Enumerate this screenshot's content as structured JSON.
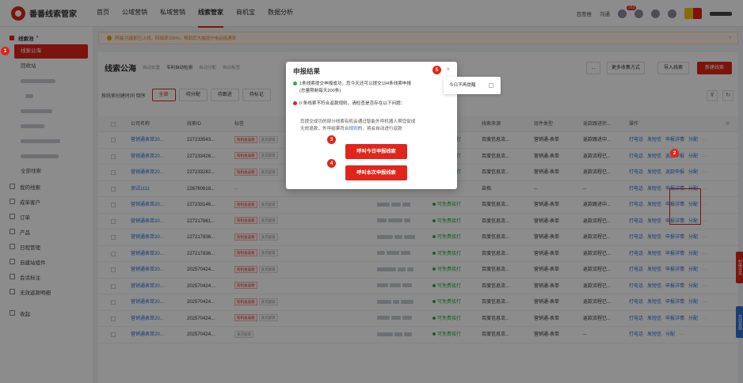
{
  "app": {
    "name": "番番线索管家"
  },
  "nav": {
    "links": [
      "首页",
      "公域营销",
      "私域营销",
      "线索管家",
      "商机宝",
      "数据分析"
    ],
    "right": {
      "baidu": "百度推",
      "chat": "沟通",
      "msg_count": "263"
    }
  },
  "sidebar": {
    "section": "线索池",
    "items": [
      "线索公海",
      "回收站"
    ],
    "all_leads": "全部线索",
    "nav": [
      "我的线索",
      "成单客户",
      "订单",
      "产品",
      "日程管理",
      "自建站组件",
      "会话标注",
      "无效返款明细",
      "收起"
    ]
  },
  "notice": {
    "text": "阿福 功能即已上线，回填率100%，帮助您大幅提升电话接通率"
  },
  "panel": {
    "title": "线索公海",
    "checks": [
      "自动去重",
      "专利自动检测",
      "自动分配",
      "自动标签"
    ],
    "buttons": {
      "more": "...",
      "collect": "更多收集方式",
      "import": "导入线索",
      "create": "新建线索"
    }
  },
  "filter": {
    "label": "按线索创建时间 倒序",
    "tabs": [
      "全部",
      "待分配",
      "待跟进",
      "待标记"
    ]
  },
  "table": {
    "headers": [
      "公司名称",
      "线索ID",
      "标签",
      "线索来源",
      "组件类型",
      "返款跟进状...",
      "操作"
    ],
    "rows": [
      {
        "company": "营销通表单20...",
        "id": "227233543...",
        "tags": [
          "有机会返款",
          "多次留资"
        ],
        "status": "可免费接打",
        "source": "百度信息流...",
        "type": "营销通-表单",
        "refund": "返款跟进中...",
        "ops": [
          "打电话",
          "发短信",
          "申报详情",
          "分配"
        ]
      },
      {
        "company": "营销通表单20...",
        "id": "227233426...",
        "tags": [
          "有机会返款",
          "多次留资"
        ],
        "status": "可免费接打",
        "source": "百度信息流...",
        "type": "营销通-表单",
        "refund": "返款流程已...",
        "ops": [
          "打电话",
          "发短信",
          "返款申报",
          "分配"
        ]
      },
      {
        "company": "营销通表单20...",
        "id": "227233282...",
        "tags": [
          "有机会返款",
          "多次留资"
        ],
        "status": "可免费接打",
        "source": "百度信息流...",
        "type": "营销通-表单",
        "refund": "返款流程已...",
        "ops": [
          "打电话",
          "发短信",
          "返款申报",
          "分配"
        ]
      },
      {
        "company": "测试1111",
        "id": "226760818...",
        "tags": [],
        "status": "",
        "source": "自拓",
        "type": "--",
        "refund": "--",
        "ops": [
          "打电话",
          "发短信",
          "申报详情",
          "分配"
        ]
      },
      {
        "company": "营销通表单20...",
        "id": "227233146...",
        "tags": [
          "有机会返款",
          "多次留资"
        ],
        "status": "可免费接打",
        "source": "百度信息流...",
        "type": "营销通-表单",
        "refund": "返款跟进中...",
        "ops": [
          "打电话",
          "发短信",
          "申报详情",
          "分配"
        ]
      },
      {
        "company": "营销通表单20...",
        "id": "227217861...",
        "tags": [
          "有机会返款",
          "多次留资"
        ],
        "status": "可免费接打",
        "source": "百度信息流...",
        "type": "营销通-表单",
        "refund": "返款流程已...",
        "ops": [
          "打电话",
          "发短信",
          "申报详情",
          "分配"
        ]
      },
      {
        "company": "营销通表单20...",
        "id": "227217836...",
        "tags": [
          "有机会返款",
          "多次留资"
        ],
        "status": "可免费接打",
        "source": "百度信息流...",
        "type": "营销通-表单",
        "refund": "返款流程已...",
        "ops": [
          "打电话",
          "发短信",
          "申报详情",
          "分配"
        ]
      },
      {
        "company": "营销通表单20...",
        "id": "227217836...",
        "tags": [
          "有机会返款",
          "多次留资"
        ],
        "status": "可免费接打",
        "source": "百度信息流...",
        "type": "营销通-表单",
        "refund": "返款流程已...",
        "ops": [
          "打电话",
          "发短信",
          "申报详情",
          "分配"
        ]
      },
      {
        "company": "营销通表单20...",
        "id": "202570424...",
        "tags": [
          "有机会返款",
          "多次留资"
        ],
        "status": "可免费接打",
        "source": "百度信息流...",
        "type": "营销通-表单",
        "refund": "返款流程已...",
        "ops": [
          "打电话",
          "发短信",
          "申报详情",
          "分配"
        ]
      },
      {
        "company": "营销通表单20...",
        "id": "202570424...",
        "tags": [
          "有机会返款"
        ],
        "status": "可免费接打",
        "source": "百度信息流...",
        "type": "营销通-表单",
        "refund": "返款流程已...",
        "ops": [
          "打电话",
          "发短信",
          "申报详情",
          "分配"
        ]
      },
      {
        "company": "营销通表单20...",
        "id": "202570424...",
        "tags": [
          "有机会返款",
          "多次留资"
        ],
        "status": "可免费接打",
        "source": "百度信息流...",
        "type": "营销通-表单",
        "refund": "返款流程已...",
        "ops": [
          "打电话",
          "发短信",
          "申报详情",
          "分配"
        ]
      },
      {
        "company": "营销通表单20...",
        "id": "202570424...",
        "tags": [
          "有机会返款",
          "多次留资"
        ],
        "status": "可免费接打",
        "source": "百度信息流...",
        "type": "营销通-表单",
        "refund": "返款流程已...",
        "ops": [
          "打电话",
          "发短信",
          "申报详情",
          "分配"
        ]
      },
      {
        "company": "营销通表单20...",
        "id": "202570424...",
        "tags": [
          "多次留资"
        ],
        "status": "可免费接打",
        "source": "百度信息流...",
        "type": "营销通-表单",
        "refund": "--",
        "ops": [
          "打电话",
          "发短信",
          "分配"
        ]
      }
    ]
  },
  "modal": {
    "title": "申报结果",
    "close": "×",
    "success_line1": "1条线索提交申报成功，您今天还可以提交194条线索申报",
    "success_line2": "(总量限制每天200条)",
    "fail_line": "0 条线索不符合返款规则，请检查是否存在以下问题：",
    "note_a": "您提交成功的部分线索有机会通过智能外呼机器人帮您促成",
    "note_b": "无效退款，外呼结果符合",
    "note_link": "规则",
    "note_c": "的，将会自动进行返款",
    "btn_today": "呼叫今日申报线索",
    "btn_this": "呼叫本次申报线索"
  },
  "tooltip": {
    "text": "今日不再提醒"
  },
  "markers": [
    "1",
    "2",
    "3",
    "4",
    "5"
  ],
  "float_tabs": {
    "red": "秒接任务",
    "blue": "在线客服"
  },
  "colors": {
    "brand": "#e1251b",
    "link": "#2f6fd6",
    "success": "#2eae4e"
  }
}
